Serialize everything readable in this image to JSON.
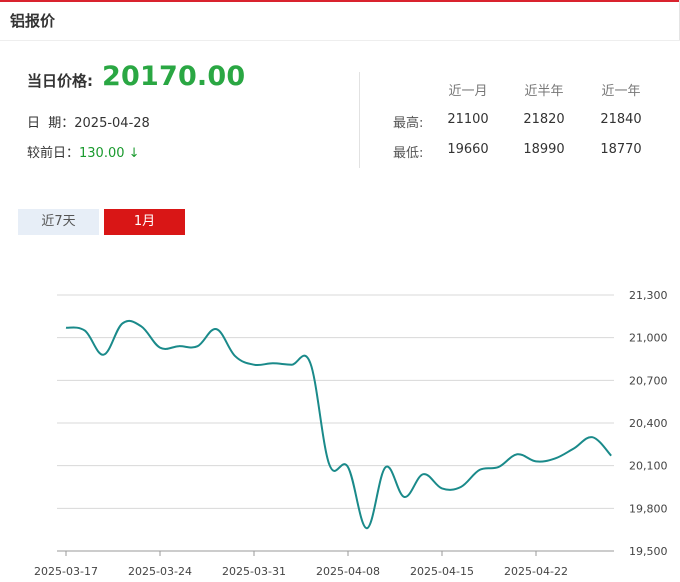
{
  "panel": {
    "title": "铝报价"
  },
  "price": {
    "label": "当日价格:",
    "value": "20170.00",
    "date_label": "日  期：",
    "date": "2025-04-28",
    "diff_label": "较前日：",
    "diff_value": "130.00",
    "diff_arrow": "↓"
  },
  "stats": {
    "columns": [
      "近一月",
      "近半年",
      "近一年"
    ],
    "rows": [
      {
        "label": "最高:",
        "values": [
          "21100",
          "21820",
          "21840"
        ]
      },
      {
        "label": "最低:",
        "values": [
          "19660",
          "18990",
          "18770"
        ]
      }
    ]
  },
  "tabs": [
    {
      "label": "近7天",
      "active": false
    },
    {
      "label": "1月",
      "active": true
    }
  ],
  "colors": {
    "accent_red": "#d91616",
    "price_green": "#2aa743",
    "line": "#1a8a8a"
  },
  "chart_data": {
    "type": "line",
    "title": "",
    "xlabel": "",
    "ylabel": "",
    "ylim": [
      19500,
      21300
    ],
    "yticks": [
      19500,
      19800,
      20100,
      20400,
      20700,
      21000,
      21300
    ],
    "ytick_labels": [
      "19,500",
      "19,800",
      "20,100",
      "20,400",
      "20,700",
      "21,000",
      "21,300"
    ],
    "grid": true,
    "x": [
      "2025-03-17",
      "2025-03-18",
      "2025-03-19",
      "2025-03-20",
      "2025-03-21",
      "2025-03-24",
      "2025-03-25",
      "2025-03-26",
      "2025-03-27",
      "2025-03-28",
      "2025-03-31",
      "2025-04-01",
      "2025-04-02",
      "2025-04-03",
      "2025-04-07",
      "2025-04-08",
      "2025-04-09",
      "2025-04-10",
      "2025-04-11",
      "2025-04-14",
      "2025-04-15",
      "2025-04-16",
      "2025-04-17",
      "2025-04-18",
      "2025-04-21",
      "2025-04-22",
      "2025-04-23",
      "2025-04-24",
      "2025-04-25",
      "2025-04-28"
    ],
    "xtick_labels": [
      "2025-03-17",
      "2025-03-24",
      "2025-03-31",
      "2025-04-08",
      "2025-04-15",
      "2025-04-22"
    ],
    "series": [
      {
        "values": [
          21070,
          21050,
          20880,
          21100,
          21080,
          20930,
          20940,
          20940,
          21060,
          20870,
          20810,
          20820,
          20810,
          20820,
          20110,
          20090,
          19660,
          20090,
          19880,
          20040,
          19940,
          19950,
          20070,
          20090,
          20180,
          20130,
          20150,
          20220,
          20300,
          20170
        ]
      }
    ]
  }
}
